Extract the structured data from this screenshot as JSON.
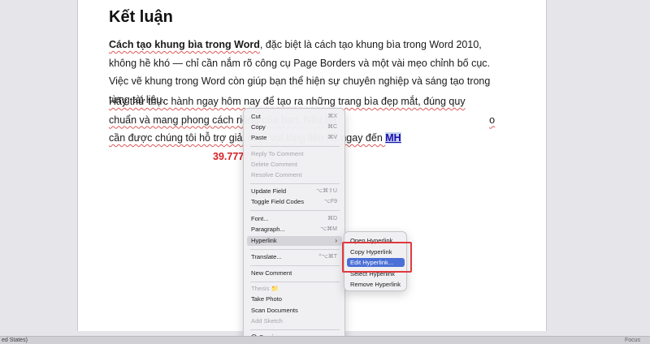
{
  "document": {
    "heading": "Kết luận",
    "p1": {
      "bold_lead": "Cách tạo khung bìa trong Word",
      "rest": ", đặc biệt là cách tạo khung bìa trong Word 2010, không hề khó — chỉ cần nắm rõ công cụ Page Borders và một vài mẹo chỉnh bố cục. Việc vẽ khung trong Word còn giúp bạn thể hiện sự chuyên nghiệp và sáng tạo trong từng tài liệu."
    },
    "p2": {
      "text_a": "Hãy thử thực hành ngay hôm nay để tạo ra những trang bìa đẹp mắt, đúng quy chuẩn và mang phong cách riêng của bạn. Nếu bạ",
      "text_b": "o cần được chúng tôi hỗ trợ giải đáp, vui lòng liên hệ ngay đến ",
      "link": "MH",
      "phone_tail": "39.7777",
      "end": "."
    }
  },
  "status_bar": {
    "left": "ed States)",
    "right": "Focus"
  },
  "context_menu": {
    "cut": {
      "label": "Cut",
      "shortcut": "⌘X"
    },
    "copy": {
      "label": "Copy",
      "shortcut": "⌘C"
    },
    "paste": {
      "label": "Paste",
      "shortcut": "⌘V"
    },
    "reply_comment": "Reply To Comment",
    "delete_comment": "Delete Comment",
    "resolve_comment": "Resolve Comment",
    "update_field": {
      "label": "Update Field",
      "shortcut": "⌥⌘⇧U"
    },
    "toggle_field_codes": {
      "label": "Toggle Field Codes",
      "shortcut": "⌥F9"
    },
    "font": {
      "label": "Font...",
      "shortcut": "⌘D"
    },
    "paragraph": {
      "label": "Paragraph...",
      "shortcut": "⌥⌘M"
    },
    "hyperlink": {
      "label": "Hyperlink",
      "arrow": "›"
    },
    "translate": {
      "label": "Translate...",
      "shortcut": "^⌥⌘T"
    },
    "new_comment": "New Comment",
    "thesis": "Thesis 📁",
    "take_photo": "Take Photo",
    "scan_documents": "Scan Documents",
    "add_sketch": "Add Sketch",
    "services": {
      "label": "Services",
      "arrow": "›"
    }
  },
  "hyperlink_submenu": {
    "open": "Open Hyperlink",
    "copy": "Copy Hyperlink",
    "edit": "Edit Hyperlink...",
    "select": "Select Hyperlink",
    "remove": "Remove Hyperlink"
  },
  "colors": {
    "selection_highlight": "#4a6fd6",
    "annotation_box": "#e0393e",
    "phone_red": "#d61f26"
  }
}
